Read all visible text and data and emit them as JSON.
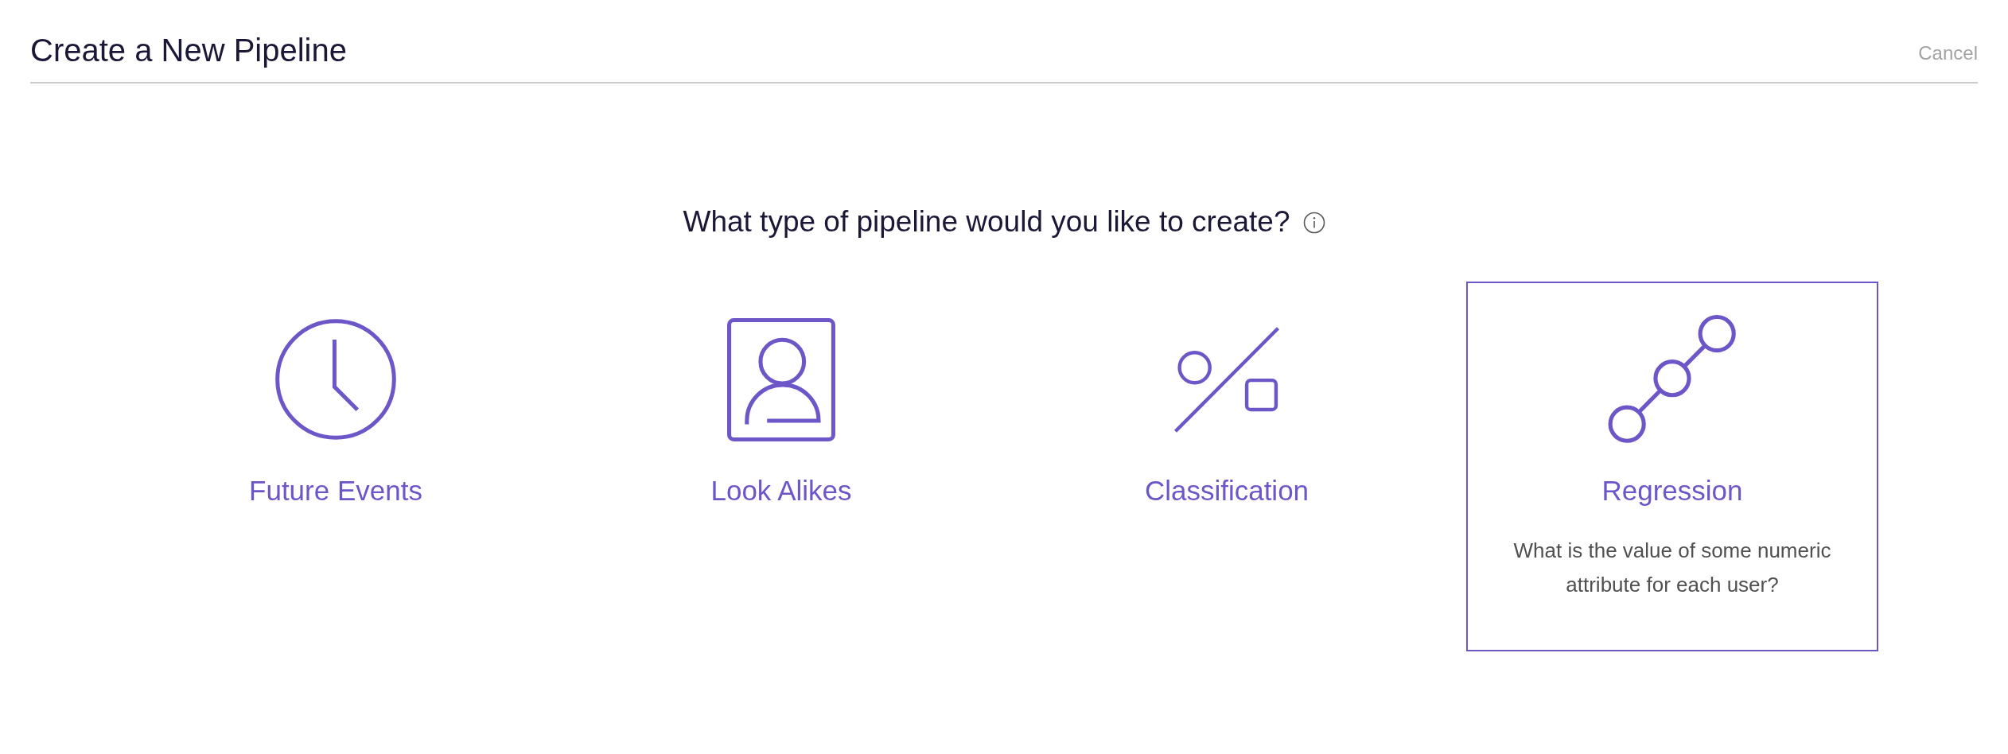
{
  "header": {
    "title": "Create a New Pipeline",
    "cancel": "Cancel"
  },
  "question": {
    "text": "What type of pipeline would you like to create?"
  },
  "cards": [
    {
      "label": "Future Events",
      "selected": false
    },
    {
      "label": "Look Alikes",
      "selected": false
    },
    {
      "label": "Classification",
      "selected": false
    },
    {
      "label": "Regression",
      "selected": true,
      "description": "What is the value of some numeric attribute for each user?"
    }
  ]
}
